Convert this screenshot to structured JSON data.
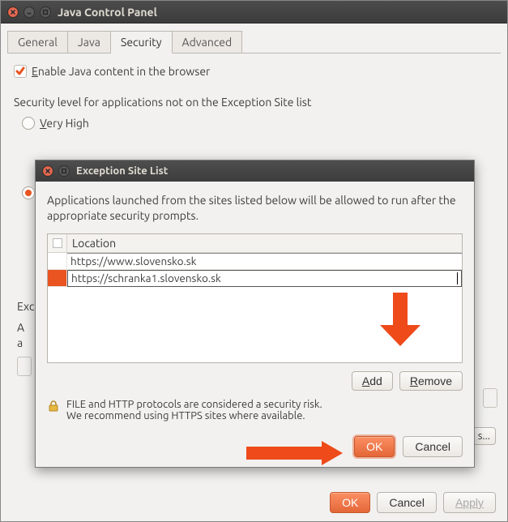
{
  "window": {
    "title": "Java Control Panel"
  },
  "tabs": {
    "general": "General",
    "java": "Java",
    "security": "Security",
    "advanced": "Advanced"
  },
  "security": {
    "enable_label": "Enable Java content in the browser",
    "section_title": "Security level for applications not on the Exception Site list",
    "very_high": "Very High"
  },
  "left_clip": {
    "line1": "Exc",
    "line2": "A",
    "line3": "a"
  },
  "dialog": {
    "title": "Exception Site List",
    "desc": "Applications launched from the sites listed below will be allowed to run after the appropriate security prompts.",
    "col_location": "Location",
    "rows": [
      {
        "url": "https://www.slovensko.sk"
      },
      {
        "url": "https://schranka1.slovensko.sk"
      }
    ],
    "add": "Add",
    "remove": "Remove",
    "warn1": "FILE and HTTP protocols are considered a security risk.",
    "warn2": "We recommend using HTTPS sites where available.",
    "ok": "OK",
    "cancel": "Cancel"
  },
  "partial_btn": "s...",
  "footer": {
    "ok": "OK",
    "cancel": "Cancel",
    "apply": "Apply"
  }
}
